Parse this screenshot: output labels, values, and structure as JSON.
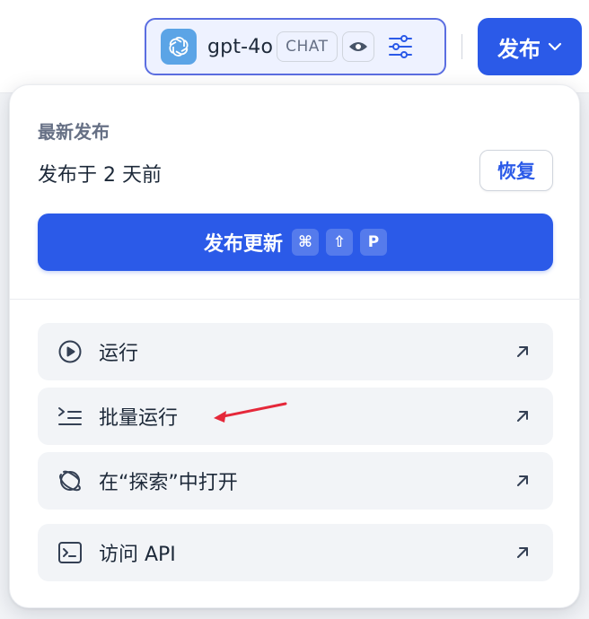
{
  "header": {
    "model": {
      "name": "gpt-4o",
      "mode_tag": "CHAT",
      "logo_icon": "openai-logo-icon",
      "vision_icon": "eye-icon",
      "settings_icon": "sliders-icon"
    },
    "publish_button": {
      "label": "发布",
      "icon": "chevron-down-icon"
    }
  },
  "publish_menu": {
    "section_label": "最新发布",
    "published_at": "发布于 2 天前",
    "restore_label": "恢复",
    "update_button": {
      "label": "发布更新",
      "shortcut": [
        "⌘",
        "⇧",
        "P"
      ]
    },
    "actions": [
      {
        "label": "运行",
        "icon": "play-circle-icon"
      },
      {
        "label": "批量运行",
        "icon": "batch-run-icon"
      },
      {
        "label": "在“探索”中打开",
        "icon": "planet-icon"
      },
      {
        "label": "访问 API",
        "icon": "terminal-icon"
      }
    ]
  },
  "colors": {
    "primary": "#2b5ae8",
    "annotation_arrow": "#e5283a"
  }
}
